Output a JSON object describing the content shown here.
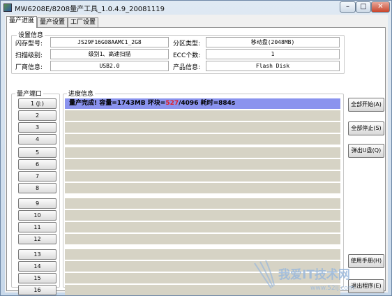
{
  "window": {
    "title": "MW6208E/8208量产工具_1.0.4.9_20081119",
    "controls": {
      "minimize": "–",
      "maximize": "□",
      "close": "✕"
    }
  },
  "tabs": [
    {
      "label": "量产进度"
    },
    {
      "label": "量产设置"
    },
    {
      "label": "工厂设置"
    }
  ],
  "settings": {
    "group_label": "设置信息",
    "flash_model_label": "闪存型号:",
    "flash_model_value": "JS29F16G08AAMC1_2G8",
    "partition_type_label": "分区类型:",
    "partition_type_value": "移动盘(2048MB)",
    "scan_level_label": "扫描级别:",
    "scan_level_value": "级别1、高速扫描",
    "ecc_label": "ECC个数:",
    "ecc_value": "1",
    "vendor_label": "厂商信息:",
    "vendor_value": "USB2.0",
    "product_label": "产品信息:",
    "product_value": "Flash Disk"
  },
  "ports_label": "量产端口",
  "progress_label": "进度信息",
  "ports": [
    "1 (J:)",
    "2",
    "3",
    "4",
    "5",
    "6",
    "7",
    "8",
    "9",
    "10",
    "11",
    "12",
    "13",
    "14",
    "15",
    "16"
  ],
  "progress": {
    "row1_prefix": "量产完成! 容量=1743MB 坏块=",
    "row1_bad": "527",
    "row1_suffix": "/4096  耗时=884s"
  },
  "buttons": {
    "start_all": "全部开始(A)",
    "stop_all": "全部停止(S)",
    "eject": "弹出U盘(Q)",
    "manual": "使用手册(H)",
    "exit": "退出程序(E)"
  },
  "watermark": {
    "text": "我爱IT技术网",
    "url": "www.52ij.com"
  }
}
